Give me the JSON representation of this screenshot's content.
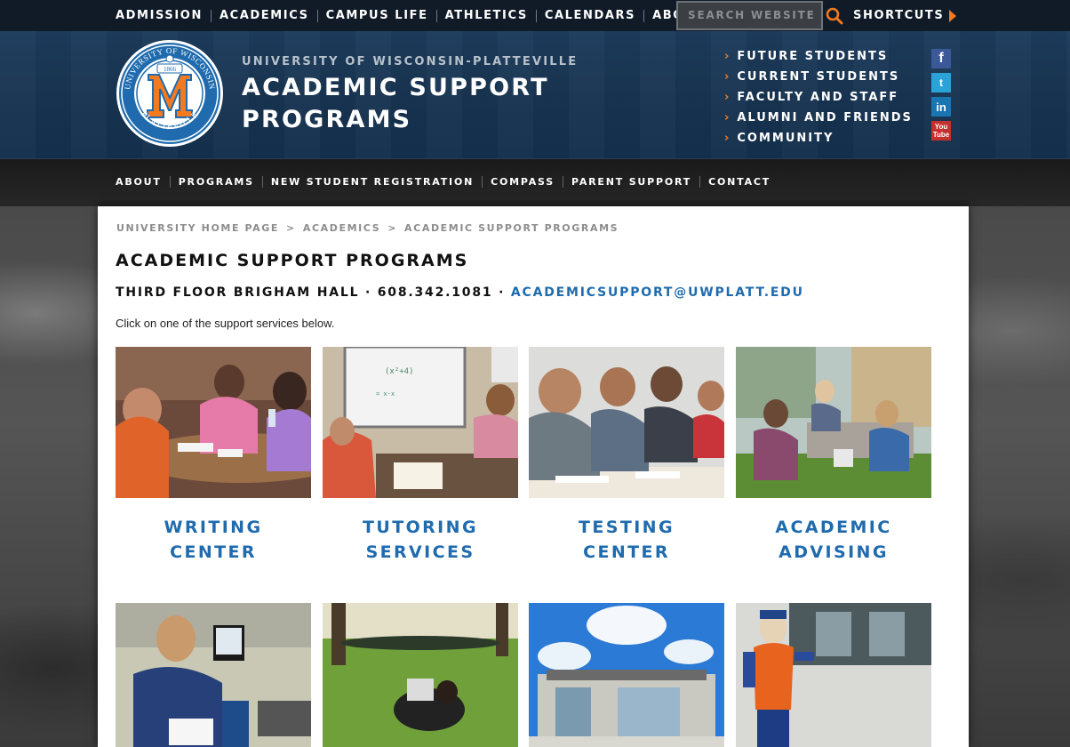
{
  "topnav": {
    "items": [
      "ADMISSION",
      "ACADEMICS",
      "CAMPUS LIFE",
      "ATHLETICS",
      "CALENDARS",
      "ABOUT"
    ],
    "search_placeholder": "SEARCH WEBSITE",
    "shortcuts": "SHORTCUTS"
  },
  "header": {
    "seal_year": "1866",
    "seal_top": "UNIVERSITY OF WISCONSIN",
    "seal_bottom": "PLATTEVILLE",
    "site_sub": "UNIVERSITY OF WISCONSIN-PLATTEVILLE",
    "site_title_line1": "ACADEMIC SUPPORT",
    "site_title_line2": "PROGRAMS",
    "audience": [
      "FUTURE STUDENTS",
      "CURRENT STUDENTS",
      "FACULTY AND STAFF",
      "ALUMNI AND FRIENDS",
      "COMMUNITY"
    ],
    "social": [
      "f",
      "t",
      "in",
      "You Tube"
    ]
  },
  "mainnav": {
    "items": [
      "ABOUT",
      "PROGRAMS",
      "NEW STUDENT REGISTRATION",
      "COMPASS",
      "PARENT SUPPORT",
      "CONTACT"
    ]
  },
  "breadcrumb": [
    "UNIVERSITY HOME PAGE",
    "ACADEMICS",
    "ACADEMIC SUPPORT PROGRAMS"
  ],
  "page": {
    "title": "ACADEMIC SUPPORT PROGRAMS",
    "contact_text": "THIRD FLOOR BRIGHAM HALL · 608.342.1081 · ",
    "contact_email": "ACADEMICSUPPORT@UWPLATT.EDU",
    "intro": "Click on one of the support services below."
  },
  "tiles": [
    {
      "line1": "WRITING",
      "line2": "CENTER"
    },
    {
      "line1": "TUTORING",
      "line2": "SERVICES"
    },
    {
      "line1": "TESTING",
      "line2": "CENTER"
    },
    {
      "line1": "ACADEMIC",
      "line2": "ADVISING"
    }
  ],
  "colors": {
    "accent_orange": "#f47a20",
    "link_blue": "#1f6bae",
    "header_navy": "#173350"
  }
}
